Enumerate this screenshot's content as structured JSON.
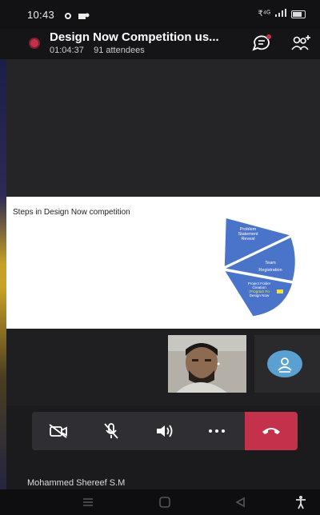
{
  "status_bar": {
    "time": "10:43",
    "signal_text": "₹⁴ᴳ"
  },
  "header": {
    "title": "Design Now Competition us...",
    "duration": "01:04:37",
    "attendees": "91 attendees",
    "record_color": "#c4314b"
  },
  "slide": {
    "title": "Steps in Design Now competition",
    "segments": [
      "Problem Statement Reveal",
      "Team Registration",
      "Project Folder Creation"
    ],
    "segment_extra": [
      "(Program Fo",
      "Design Now"
    ],
    "segment_color": "#4a74c9"
  },
  "controls": {
    "camera": "camera-off",
    "mic": "mic-off",
    "speaker": "speaker",
    "more": "more",
    "hangup": "hang-up",
    "hangup_color": "#c4314b"
  },
  "participant": {
    "name": "Mohammed Shereef S.M"
  }
}
